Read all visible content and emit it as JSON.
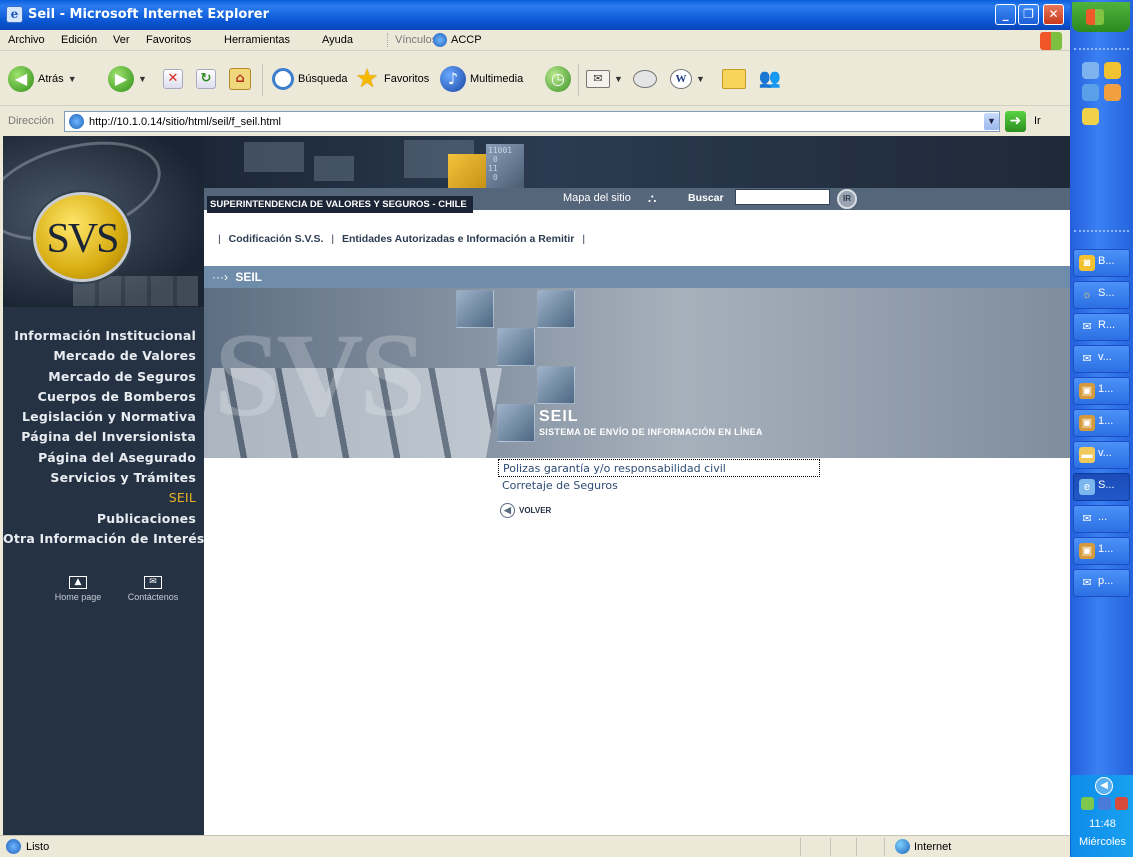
{
  "window": {
    "title": "Seil - Microsoft Internet Explorer"
  },
  "menubar": {
    "items": [
      "Archivo",
      "Edición",
      "Ver",
      "Favoritos",
      "Herramientas",
      "Ayuda"
    ],
    "links_label": "Vínculos",
    "links_item": "ACCP"
  },
  "toolbar": {
    "back_label": "Atrás",
    "search_label": "Búsqueda",
    "favorites_label": "Favoritos",
    "media_label": "Multimedia"
  },
  "address": {
    "label": "Dirección",
    "url": "http://10.1.0.14/sitio/html/seil/f_seil.html",
    "go_label": "Ir"
  },
  "header": {
    "org_name": "SUPERINTENDENCIA DE VALORES Y SEGUROS - CHILE",
    "site_map": "Mapa del sitio",
    "search_label": "Buscar",
    "search_value": "",
    "go_button": "IR"
  },
  "sidebar": {
    "logo_text": "SVS",
    "nav": [
      "Información Institucional",
      "Mercado de Valores",
      "Mercado de Seguros",
      "Cuerpos de Bomberos",
      "Legislación y Normativa",
      "Página del Inversionista",
      "Página del Asegurado",
      "Servicios y Trámites",
      "SEIL",
      "Publicaciones",
      "Otra Información de Interés"
    ],
    "home_label": "Home page",
    "contact_label": "Contáctenos"
  },
  "topnav": {
    "sep": "|",
    "links": [
      "Codificación S.V.S.",
      "Entidades Autorizadas e Información a Remitir"
    ]
  },
  "section": {
    "arrow": "···›",
    "title": "SEIL"
  },
  "hero": {
    "watermark": "SVS",
    "title": "SEIL",
    "subtitle": "SISTEMA DE ENVÍO DE INFORMACIÓN EN LÍNEA",
    "banner_digits": "11001\n 0\n11\n 0"
  },
  "options": {
    "items": [
      "Polizas garantía y/o responsabilidad civil",
      "Corretaje de Seguros"
    ],
    "back_label": "VOLVER"
  },
  "status": {
    "text": "Listo",
    "zone": "Internet"
  },
  "taskbar": {
    "buttons": [
      "B...",
      "S...",
      "R...",
      "v...",
      "1...",
      "1...",
      "v...",
      "S...",
      "...",
      "1...",
      "p..."
    ],
    "time": "11:48",
    "day": "Miércoles"
  }
}
